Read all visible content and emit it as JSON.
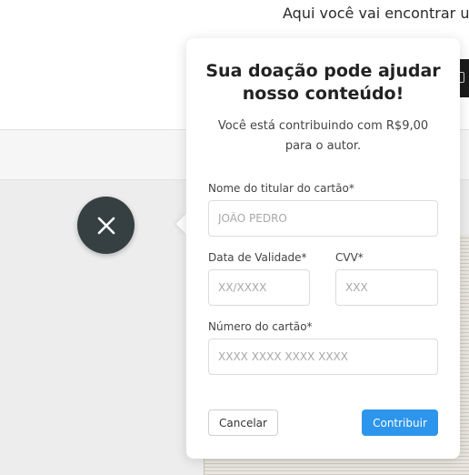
{
  "background": {
    "tagline": "Aqui você vai encontrar u"
  },
  "close_button": {
    "icon": "close-icon"
  },
  "donation_modal": {
    "title_line1": "Sua doação pode ajudar",
    "title_line2": "nosso conteúdo!",
    "subtitle_line1": "Você está contribuindo com R$9,00",
    "subtitle_line2": "para o autor.",
    "card_holder": {
      "label": "Nome do titular do cartão*",
      "placeholder": "JOÃO PEDRO"
    },
    "expiry": {
      "label": "Data de Validade*",
      "placeholder": "XX/XXXX"
    },
    "cvv": {
      "label": "CVV*",
      "placeholder": "XXX"
    },
    "card_number": {
      "label": "Número do cartão*",
      "placeholder": "XXXX XXXX XXXX XXXX"
    },
    "cancel_label": "Cancelar",
    "submit_label": "Contribuir"
  },
  "colors": {
    "accent": "#2d95ec",
    "fab": "#364043"
  }
}
